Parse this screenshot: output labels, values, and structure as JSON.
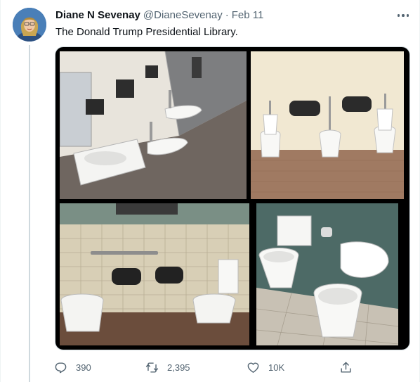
{
  "tweet": {
    "author_name": "Diane N Sevenay",
    "author_handle": "@DianeSevenay",
    "separator": "·",
    "date": "Feb 11",
    "text": "The Donald Trump Presidential Library."
  },
  "media": {
    "photo_count": 4
  },
  "actions": {
    "reply_count": "390",
    "retweet_count": "2,395",
    "like_count": "10K"
  },
  "icons": {
    "more": "more-options-icon",
    "reply": "reply-icon",
    "retweet": "retweet-icon",
    "like": "like-icon",
    "share": "share-icon"
  },
  "colors": {
    "text_primary": "#0f1419",
    "text_secondary": "#536471",
    "border": "#cfd9de"
  }
}
